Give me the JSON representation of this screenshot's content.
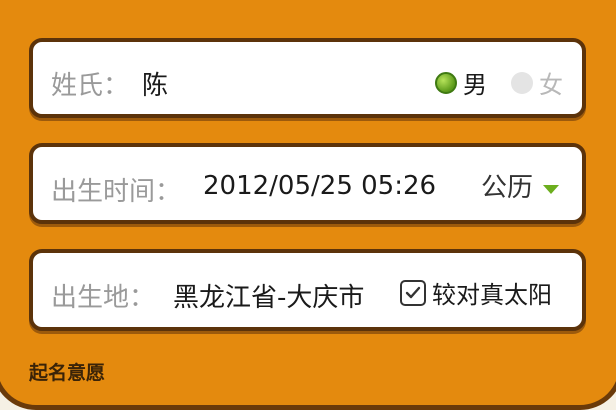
{
  "name_row": {
    "label": "姓氏：",
    "value": "陈",
    "gender_male": "男",
    "gender_female": "女",
    "selected_gender": "男"
  },
  "time_row": {
    "label": "出生时间：",
    "value": "2012/05/25 05:26",
    "calendar_type": "公历"
  },
  "place_row": {
    "label": "出生地：",
    "value": "黑龙江省-大庆市",
    "solar_time_label": "较对真太阳"
  },
  "section": {
    "title": "起名意愿"
  },
  "colors": {
    "panel": "#e48a0e",
    "border": "#5c330a",
    "accent_green": "#6cae1e"
  }
}
